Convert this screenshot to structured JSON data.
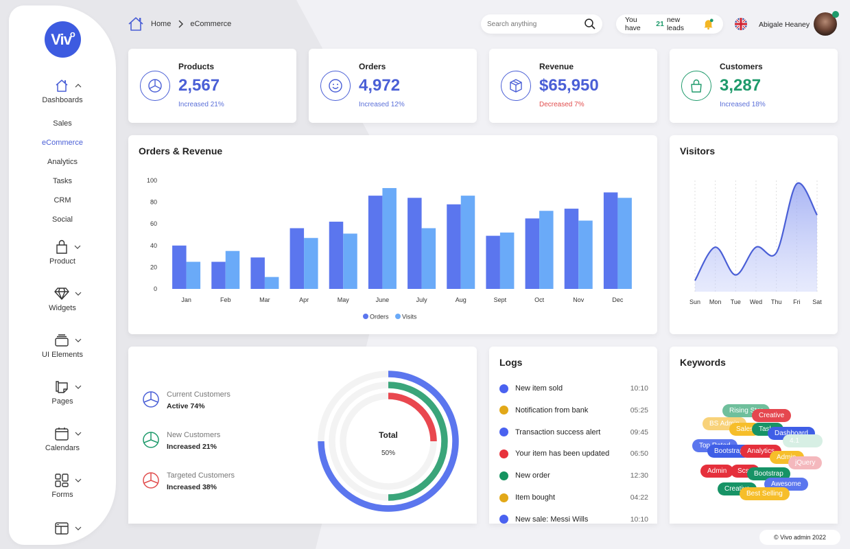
{
  "brand": {
    "logo_text": "Viv",
    "logo_sup": "o",
    "color": "#3d5be0"
  },
  "breadcrumb": {
    "home": "Home",
    "current": "eCommerce"
  },
  "header": {
    "search_placeholder": "Search anything",
    "leads_prefix": "You have",
    "leads_count": "21",
    "leads_suffix": "new leads",
    "user_name": "Abigale Heaney"
  },
  "sidebar": {
    "dashboards": {
      "label": "Dashboards",
      "expanded": true
    },
    "sub_items": [
      {
        "label": "Sales",
        "active": false
      },
      {
        "label": "eCommerce",
        "active": true
      },
      {
        "label": "Analytics",
        "active": false
      },
      {
        "label": "Tasks",
        "active": false
      },
      {
        "label": "CRM",
        "active": false
      },
      {
        "label": "Social",
        "active": false
      }
    ],
    "groups": [
      {
        "label": "Product",
        "icon": "bag-icon"
      },
      {
        "label": "Widgets",
        "icon": "diamond-icon"
      },
      {
        "label": "UI Elements",
        "icon": "layers-icon"
      },
      {
        "label": "Pages",
        "icon": "pages-icon"
      },
      {
        "label": "Calendars",
        "icon": "calendar-icon"
      },
      {
        "label": "Forms",
        "icon": "grid-icon"
      },
      {
        "label": "",
        "icon": "layout-icon"
      }
    ]
  },
  "stats": [
    {
      "title": "Products",
      "value": "2,567",
      "sub": "Increased 21%",
      "trend": "up",
      "icon": "pie-chart-icon"
    },
    {
      "title": "Orders",
      "value": "4,972",
      "sub": "Increased 12%",
      "trend": "up",
      "icon": "smile-icon"
    },
    {
      "title": "Revenue",
      "value": "$65,950",
      "sub": "Decreased 7%",
      "trend": "down",
      "icon": "box-icon"
    },
    {
      "title": "Customers",
      "value": "3,287",
      "sub": "Increased 18%",
      "trend": "up",
      "icon": "shopping-bag-icon"
    }
  ],
  "orders_revenue": {
    "title": "Orders & Revenue"
  },
  "visitors": {
    "title": "Visitors"
  },
  "chart_data": [
    {
      "type": "bar",
      "title": "Orders & Revenue",
      "categories": [
        "Jan",
        "Feb",
        "Mar",
        "Apr",
        "May",
        "June",
        "July",
        "Aug",
        "Sept",
        "Oct",
        "Nov",
        "Dec"
      ],
      "series": [
        {
          "name": "Orders",
          "color": "#5b76ee",
          "values": [
            40,
            25,
            29,
            56,
            62,
            86,
            84,
            78,
            49,
            65,
            74,
            89
          ]
        },
        {
          "name": "Visits",
          "color": "#6aaaf8",
          "values": [
            25,
            35,
            11,
            47,
            51,
            93,
            56,
            86,
            52,
            72,
            63,
            84
          ]
        }
      ],
      "yticks": [
        0,
        20,
        40,
        60,
        80,
        100
      ],
      "ylim": [
        0,
        100
      ],
      "legend": "bottom-center",
      "xlabel": "",
      "ylabel": ""
    },
    {
      "type": "area",
      "title": "Visitors",
      "categories": [
        "Sun",
        "Mon",
        "Tue",
        "Wed",
        "Thu",
        "Fri",
        "Sat"
      ],
      "series": [
        {
          "name": "Visitors",
          "color": "#4a5fd6",
          "values": [
            10,
            40,
            15,
            40,
            35,
            97,
            69
          ]
        }
      ],
      "ylim": [
        0,
        100
      ],
      "grid": "vertical-dashed"
    },
    {
      "type": "radial-bar",
      "center_label": "Total",
      "center_value": "50%",
      "series": [
        {
          "name": "Current Customers",
          "color": "#5b76ee",
          "value": 75
        },
        {
          "name": "New Customers",
          "color": "#3aa57a",
          "value": 50
        },
        {
          "name": "Targeted Customers",
          "color": "#e9474f",
          "value": 25
        }
      ]
    }
  ],
  "customers": [
    {
      "name": "Current Customers",
      "value": "Active 74%",
      "color": "#4a5fd6"
    },
    {
      "name": "New Customers",
      "value": "Increased 21%",
      "color": "#1e9a6b"
    },
    {
      "name": "Targeted Customers",
      "value": "Increased 38%",
      "color": "#e14d4d"
    }
  ],
  "radial": {
    "center_label": "Total",
    "center_value": "50%"
  },
  "logs": {
    "title": "Logs",
    "items": [
      {
        "text": "New item sold",
        "time": "10:10",
        "color": "#4a62f0"
      },
      {
        "text": "Notification from bank",
        "time": "05:25",
        "color": "#e2a818"
      },
      {
        "text": "Transaction success alert",
        "time": "09:45",
        "color": "#4a62f0"
      },
      {
        "text": "Your item has been updated",
        "time": "06:50",
        "color": "#e8323c"
      },
      {
        "text": "New order",
        "time": "12:30",
        "color": "#15935f"
      },
      {
        "text": "Item bought",
        "time": "04:22",
        "color": "#e2a818"
      },
      {
        "text": "New sale: Messi Wills",
        "time": "10:10",
        "color": "#4a62f0"
      }
    ]
  },
  "keywords": {
    "title": "Keywords",
    "items": [
      {
        "text": "Rising Star",
        "color": "#6fbf9c"
      },
      {
        "text": "Creative",
        "color": "#e5474f"
      },
      {
        "text": "BS Admin",
        "color": "#f8d27a"
      },
      {
        "text": "Sales",
        "color": "#f6be2a"
      },
      {
        "text": "Tasks",
        "color": "#179366"
      },
      {
        "text": "Dashboard",
        "color": "#3f5ee6"
      },
      {
        "text": "4.1",
        "color": "#d7efe4"
      },
      {
        "text": "Top Rated",
        "color": "#5b76ee"
      },
      {
        "text": "Bootstrap",
        "color": "#3f5ee6"
      },
      {
        "text": "Analytics",
        "color": "#e5303c"
      },
      {
        "text": "Admin",
        "color": "#f6be2a"
      },
      {
        "text": "jQuery",
        "color": "#f4b8bd"
      },
      {
        "text": "Admin",
        "color": "#e5303c"
      },
      {
        "text": "Scss",
        "color": "#e5303c"
      },
      {
        "text": "Bootstrap",
        "color": "#179366"
      },
      {
        "text": "Awesome",
        "color": "#5b76ee"
      },
      {
        "text": "Creative",
        "color": "#179366"
      },
      {
        "text": "Best Selling",
        "color": "#f6be2a"
      }
    ]
  },
  "footer": {
    "text": "© Vivo admin 2022"
  },
  "colors": {
    "accent": "#4a5fd6",
    "success": "#1e9a6b",
    "danger": "#e14d4d",
    "warning": "#e2a818"
  }
}
